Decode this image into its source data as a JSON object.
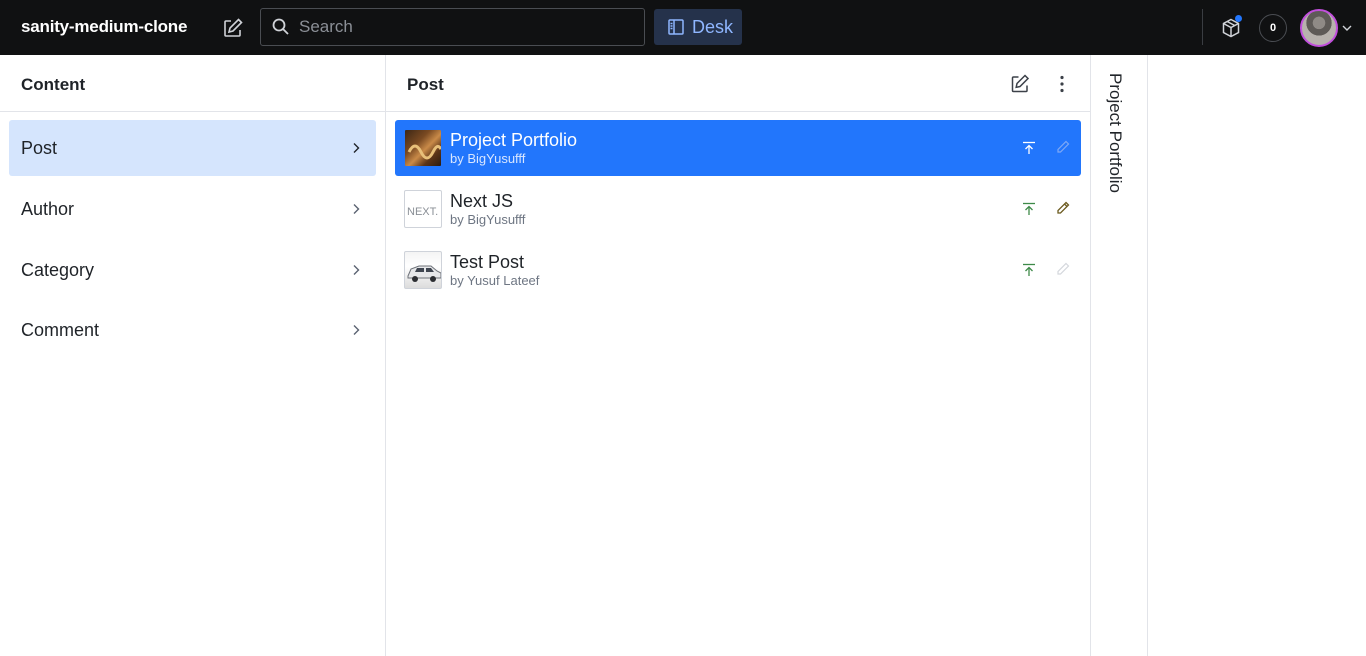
{
  "navbar": {
    "brand": "sanity-medium-clone",
    "search_placeholder": "Search",
    "desk_label": "Desk",
    "notification_count": "0"
  },
  "content_pane": {
    "title": "Content",
    "items": [
      {
        "label": "Post",
        "active": true
      },
      {
        "label": "Author",
        "active": false
      },
      {
        "label": "Category",
        "active": false
      },
      {
        "label": "Comment",
        "active": false
      }
    ]
  },
  "post_pane": {
    "title": "Post",
    "documents": [
      {
        "title": "Project Portfolio",
        "subtitle": "by BigYusufff",
        "selected": true
      },
      {
        "title": "Next JS",
        "subtitle": "by BigYusufff",
        "selected": false
      },
      {
        "title": "Test Post",
        "subtitle": "by Yusuf Lateef",
        "selected": false
      }
    ]
  },
  "editor_pane": {
    "title": "Project Portfolio"
  },
  "colors": {
    "navbar_bg": "#101112",
    "accent": "#2276fc",
    "active_item_bg": "#d5e5fd",
    "published_green": "#3e8a49",
    "draft_edit": "#6b5a1f"
  }
}
